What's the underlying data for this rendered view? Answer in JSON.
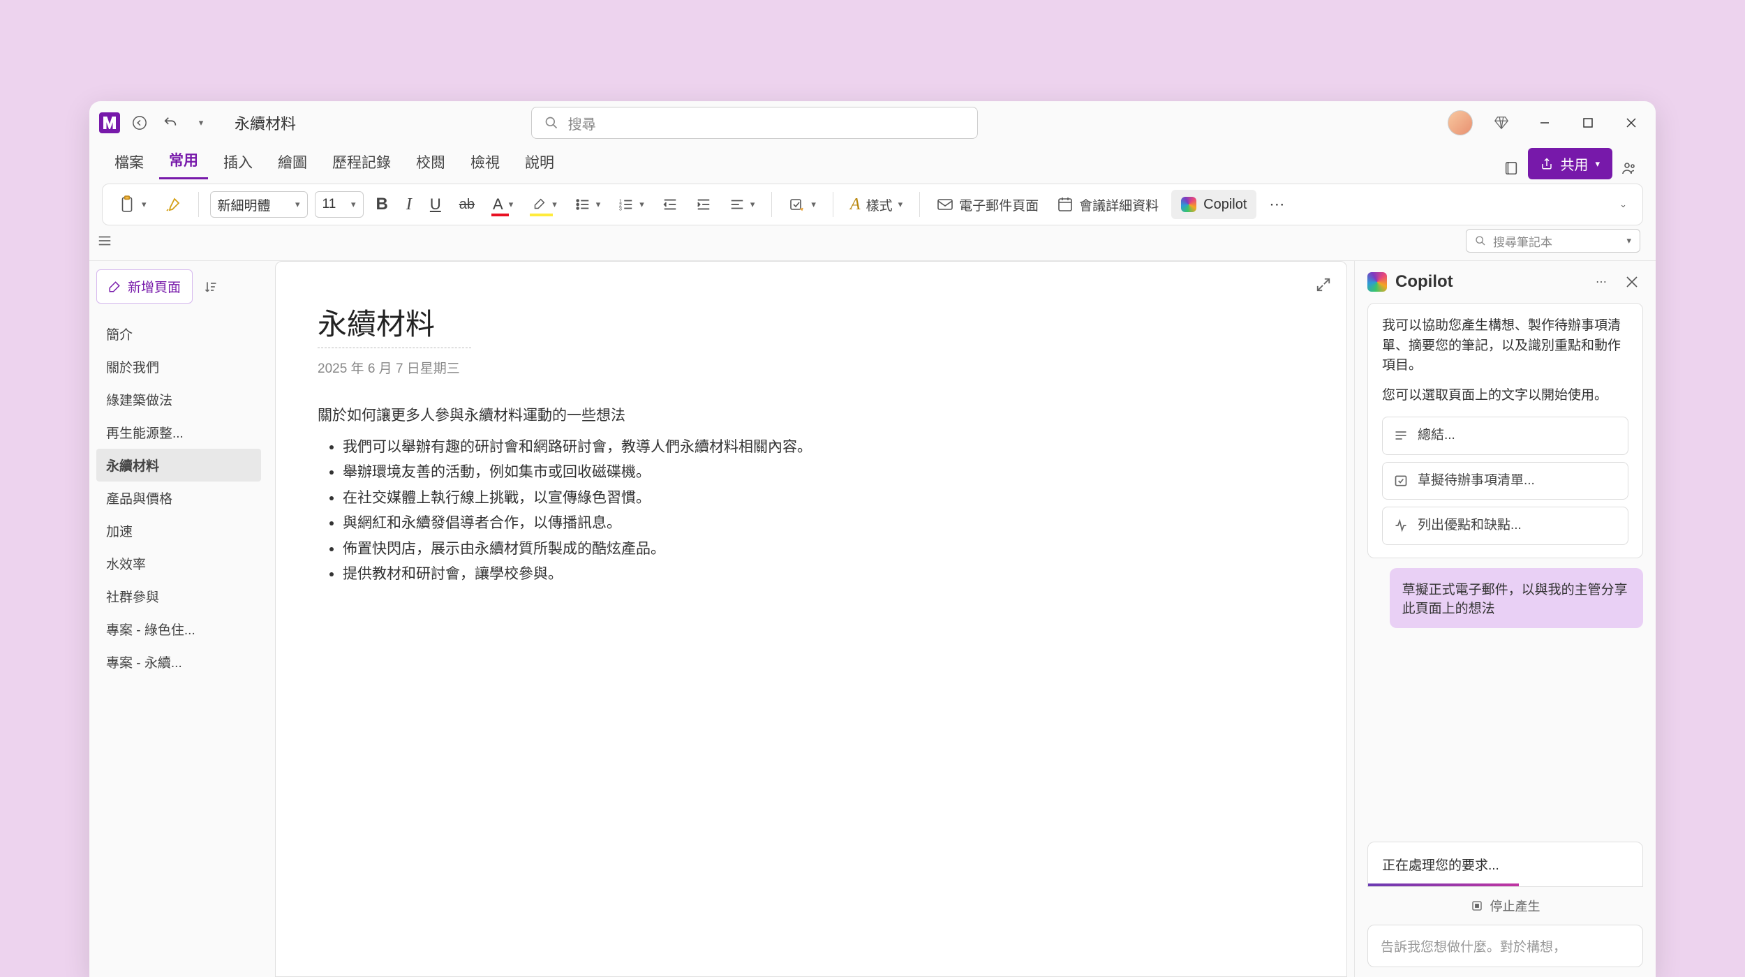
{
  "title": "永續材料",
  "search_placeholder": "搜尋",
  "tabs": [
    "檔案",
    "常用",
    "插入",
    "繪圖",
    "歷程記錄",
    "校閱",
    "檢視",
    "說明"
  ],
  "active_tab": 1,
  "share_label": "共用",
  "ribbon": {
    "font_name": "新細明體",
    "font_size": "11",
    "styles_label": "樣式",
    "email_label": "電子郵件頁面",
    "meeting_label": "會議詳細資料",
    "copilot_label": "Copilot"
  },
  "notesearch_placeholder": "搜尋筆記本",
  "add_page_label": "新增頁面",
  "pages": [
    "簡介",
    "關於我們",
    "綠建築做法",
    "再生能源整...",
    "永續材料",
    "產品與價格",
    "加速",
    "水效率",
    "社群參與",
    "專案 - 綠色住...",
    "專案 - 永續..."
  ],
  "active_page": 4,
  "note": {
    "title": "永續材料",
    "date": "2025 年 6 月 7 日星期三",
    "intro": "關於如何讓更多人參與永續材料運動的一些想法",
    "bullets": [
      "我們可以舉辦有趣的研討會和網路研討會，教導人們永續材料相關內容。",
      "舉辦環境友善的活動，例如集市或回收磁碟機。",
      "在社交媒體上執行線上挑戰，以宣傳綠色習慣。",
      "與網紅和永續發倡導者合作，以傳播訊息。",
      "佈置快閃店，展示由永續材質所製成的酷炫產品。",
      "提供教材和研討會，讓學校參與。"
    ]
  },
  "copilot": {
    "title": "Copilot",
    "intro1": "我可以協助您產生構想、製作待辦事項清單、摘要您的筆記，以及識別重點和動作項目。",
    "intro2": "您可以選取頁面上的文字以開始使用。",
    "suggestions": [
      "總結...",
      "草擬待辦事項清單...",
      "列出優點和缺點..."
    ],
    "user_msg": "草擬正式電子郵件，以與我的主管分享此頁面上的想法",
    "processing": "正在處理您的要求...",
    "stop_label": "停止產生",
    "input_placeholder": "告訴我您想做什麼。對於構想，"
  }
}
